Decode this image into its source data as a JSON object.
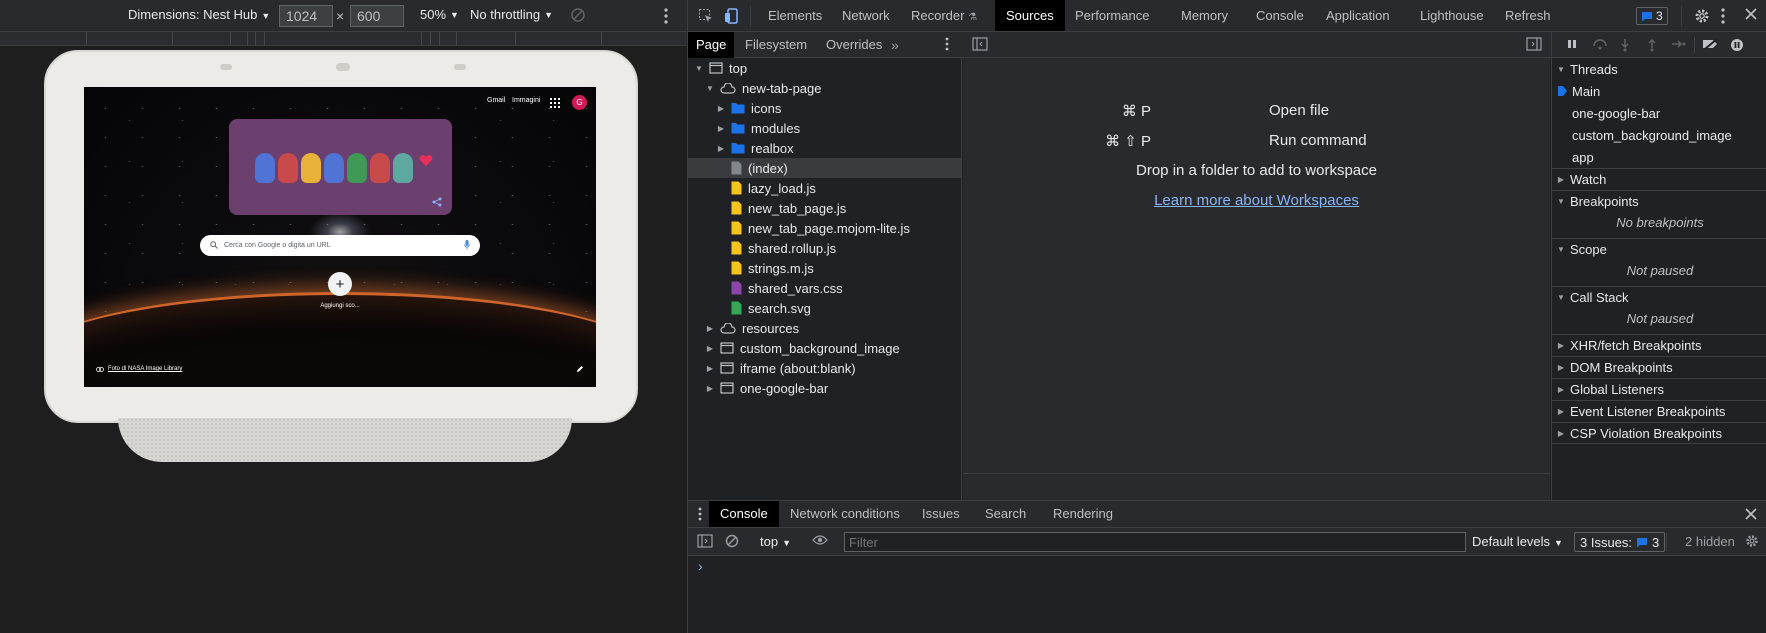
{
  "emulation": {
    "device_label": "Dimensions: Nest Hub",
    "width": "1024",
    "height": "600",
    "times": "×",
    "zoom": "50%",
    "throttling": "No throttling"
  },
  "ntp": {
    "gmail": "Gmail",
    "images": "Immagini",
    "avatar_letter": "G",
    "search_placeholder": "Cerca con Google o digita un URL",
    "shortcut_label": "Aggiungi sco...",
    "shortcut_plus": "+",
    "credit": "Foto di NASA Image Library"
  },
  "devtools": {
    "main_tabs": [
      "Elements",
      "Network",
      "Recorder",
      "Sources",
      "Performance",
      "Memory",
      "Console",
      "Application",
      "Lighthouse",
      "Refresh"
    ],
    "active_tab": "Sources",
    "issues_count": "3",
    "navigator_tabs": [
      "Page",
      "Filesystem",
      "Overrides"
    ],
    "tree": [
      {
        "label": "top",
        "indent": 0,
        "arrow": "down",
        "icon": "frame-icon"
      },
      {
        "label": "new-tab-page",
        "indent": 1,
        "arrow": "down",
        "icon": "cloud-icon"
      },
      {
        "label": "icons",
        "indent": 2,
        "arrow": "right",
        "icon": "folder-icon"
      },
      {
        "label": "modules",
        "indent": 2,
        "arrow": "right",
        "icon": "folder-icon"
      },
      {
        "label": "realbox",
        "indent": 2,
        "arrow": "right",
        "icon": "folder-icon"
      },
      {
        "label": "(index)",
        "indent": 2,
        "arrow": "",
        "icon": "document-icon",
        "selected": true
      },
      {
        "label": "lazy_load.js",
        "indent": 2,
        "arrow": "",
        "icon": "js-file-icon"
      },
      {
        "label": "new_tab_page.js",
        "indent": 2,
        "arrow": "",
        "icon": "js-file-icon"
      },
      {
        "label": "new_tab_page.mojom-lite.js",
        "indent": 2,
        "arrow": "",
        "icon": "js-file-icon"
      },
      {
        "label": "shared.rollup.js",
        "indent": 2,
        "arrow": "",
        "icon": "js-file-icon"
      },
      {
        "label": "strings.m.js",
        "indent": 2,
        "arrow": "",
        "icon": "js-file-icon"
      },
      {
        "label": "shared_vars.css",
        "indent": 2,
        "arrow": "",
        "icon": "css-file-icon"
      },
      {
        "label": "search.svg",
        "indent": 2,
        "arrow": "",
        "icon": "image-file-icon"
      },
      {
        "label": "resources",
        "indent": 1,
        "arrow": "right",
        "icon": "cloud-icon"
      },
      {
        "label": "custom_background_image",
        "indent": 1,
        "arrow": "right",
        "icon": "frame-icon"
      },
      {
        "label": "iframe (about:blank)",
        "indent": 1,
        "arrow": "right",
        "icon": "frame-icon"
      },
      {
        "label": "one-google-bar",
        "indent": 1,
        "arrow": "right",
        "icon": "frame-icon"
      }
    ],
    "editor": {
      "open_file_keys": "⌘ P",
      "open_file": "Open file",
      "run_command_keys": "⌘ ⇧ P",
      "run_command": "Run command",
      "drop_message": "Drop in a folder to add to workspace",
      "learn_more": "Learn more about Workspaces"
    },
    "debugger": {
      "threads_title": "Threads",
      "threads": [
        "Main",
        "one-google-bar",
        "custom_background_image",
        "app"
      ],
      "watch": "Watch",
      "breakpoints": "Breakpoints",
      "no_breakpoints": "No breakpoints",
      "scope": "Scope",
      "scope_status": "Not paused",
      "call_stack": "Call Stack",
      "call_stack_status": "Not paused",
      "xhr": "XHR/fetch Breakpoints",
      "dom": "DOM Breakpoints",
      "global": "Global Listeners",
      "event": "Event Listener Breakpoints",
      "csp": "CSP Violation Breakpoints"
    },
    "drawer": {
      "tabs": [
        "Console",
        "Network conditions",
        "Issues",
        "Search",
        "Rendering"
      ],
      "active_tab": "Console",
      "context": "top",
      "filter_placeholder": "Filter",
      "levels": "Default levels",
      "issues_label": "3 Issues:",
      "issues_count": "3",
      "hidden": "2 hidden",
      "prompt": "›"
    }
  },
  "colors": {
    "accent": "#8ab4f8",
    "folder": "#1a73e8",
    "js_file": "#f5c518",
    "css_file": "#8e44ad",
    "svg_file": "#34a853",
    "avatar": "#d11b54"
  }
}
